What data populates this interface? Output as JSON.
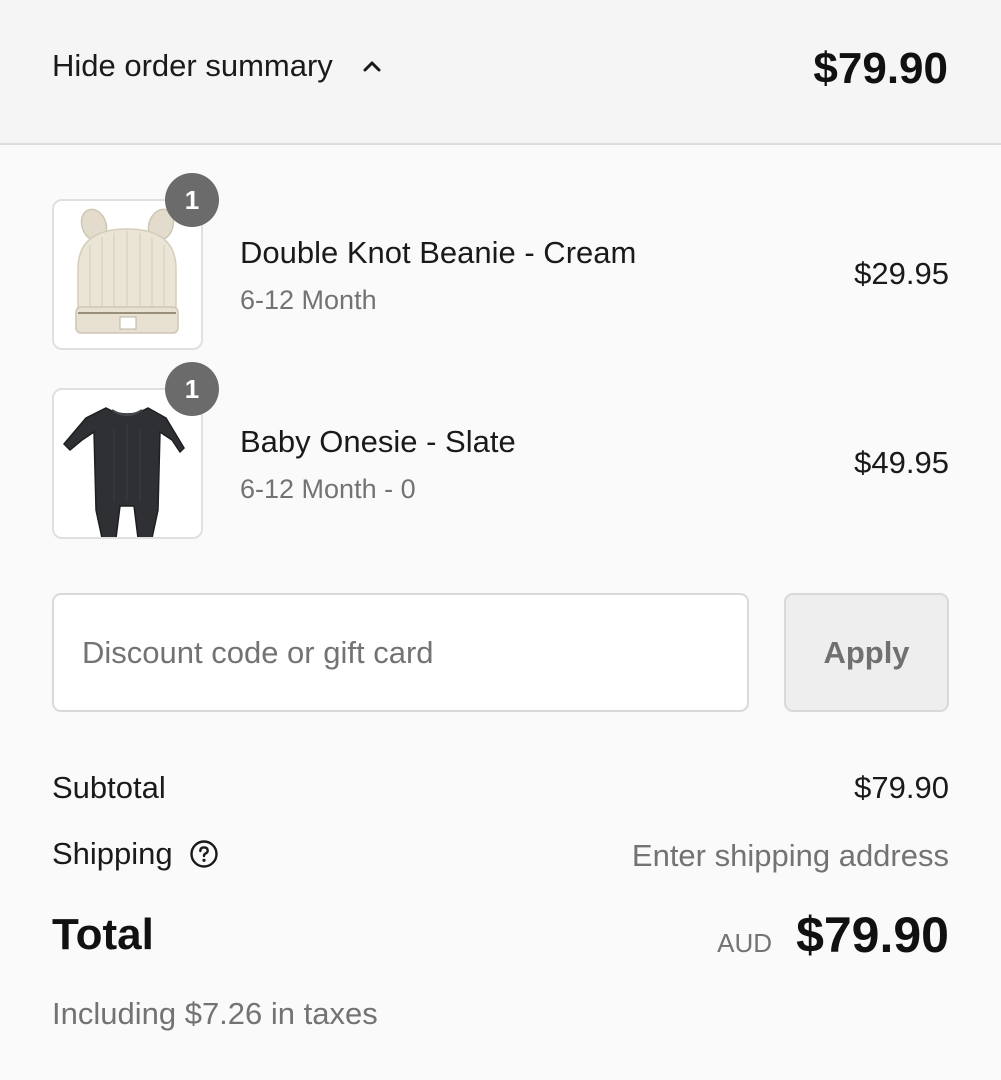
{
  "summary": {
    "toggle_label": "Hide order summary",
    "header_total": "$79.90",
    "chevron_icon": "chevron-up-icon"
  },
  "items": [
    {
      "name": "Double Knot Beanie - Cream",
      "variant": "6-12 Month",
      "price": "$29.95",
      "quantity": "1",
      "image_icon": "beanie-product-image",
      "color": "#ece6d9"
    },
    {
      "name": "Baby Onesie - Slate",
      "variant": "6-12 Month - 0",
      "price": "$49.95",
      "quantity": "1",
      "image_icon": "onesie-product-image",
      "color": "#2e3033"
    }
  ],
  "discount": {
    "placeholder": "Discount code or gift card",
    "value": "",
    "apply_label": "Apply"
  },
  "totals": {
    "subtotal_label": "Subtotal",
    "subtotal_value": "$79.90",
    "shipping_label": "Shipping",
    "shipping_value": "Enter shipping address",
    "shipping_help_icon": "question-circle-icon",
    "total_label": "Total",
    "currency": "AUD",
    "total_value": "$79.90",
    "tax_note": "Including $7.26 in taxes"
  },
  "colors": {
    "header_bg": "#f5f5f5",
    "page_bg": "#fafafa",
    "badge_bg": "#6b6b6b",
    "muted_text": "#737373"
  }
}
